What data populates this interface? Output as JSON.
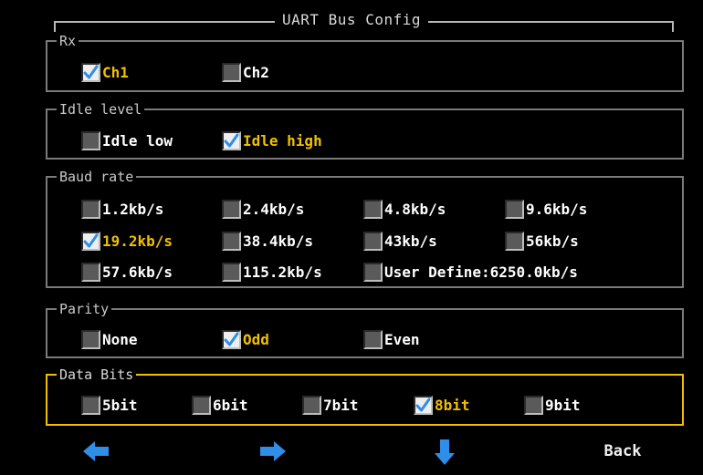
{
  "title": "UART Bus Config",
  "colors": {
    "selected_text": "#f0c000",
    "active_group_border": "#f0c000",
    "arrow": "#2f8ee8"
  },
  "groups": {
    "rx": {
      "label": "Rx",
      "options": [
        {
          "label": "Ch1",
          "checked": true
        },
        {
          "label": "Ch2",
          "checked": false
        }
      ]
    },
    "idle": {
      "label": "Idle level",
      "options": [
        {
          "label": "Idle low",
          "checked": false
        },
        {
          "label": "Idle high",
          "checked": true
        }
      ]
    },
    "baud": {
      "label": "Baud rate",
      "options": [
        {
          "label": "1.2kb/s",
          "checked": false
        },
        {
          "label": "2.4kb/s",
          "checked": false
        },
        {
          "label": "4.8kb/s",
          "checked": false
        },
        {
          "label": "9.6kb/s",
          "checked": false
        },
        {
          "label": "19.2kb/s",
          "checked": true
        },
        {
          "label": "38.4kb/s",
          "checked": false
        },
        {
          "label": "43kb/s",
          "checked": false
        },
        {
          "label": "56kb/s",
          "checked": false
        },
        {
          "label": "57.6kb/s",
          "checked": false
        },
        {
          "label": "115.2kb/s",
          "checked": false
        },
        {
          "label": "User Define:6250.0kb/s",
          "checked": false
        }
      ]
    },
    "parity": {
      "label": "Parity",
      "options": [
        {
          "label": "None",
          "checked": false
        },
        {
          "label": "Odd",
          "checked": true
        },
        {
          "label": "Even",
          "checked": false
        }
      ]
    },
    "databits": {
      "label": "Data Bits",
      "active": true,
      "options": [
        {
          "label": "5bit",
          "checked": false
        },
        {
          "label": "6bit",
          "checked": false
        },
        {
          "label": "7bit",
          "checked": false
        },
        {
          "label": "8bit",
          "checked": true
        },
        {
          "label": "9bit",
          "checked": false
        }
      ]
    }
  },
  "nav": {
    "left_icon": "arrow-left-icon",
    "right_icon": "arrow-right-icon",
    "down_icon": "arrow-down-icon",
    "back_label": "Back"
  }
}
